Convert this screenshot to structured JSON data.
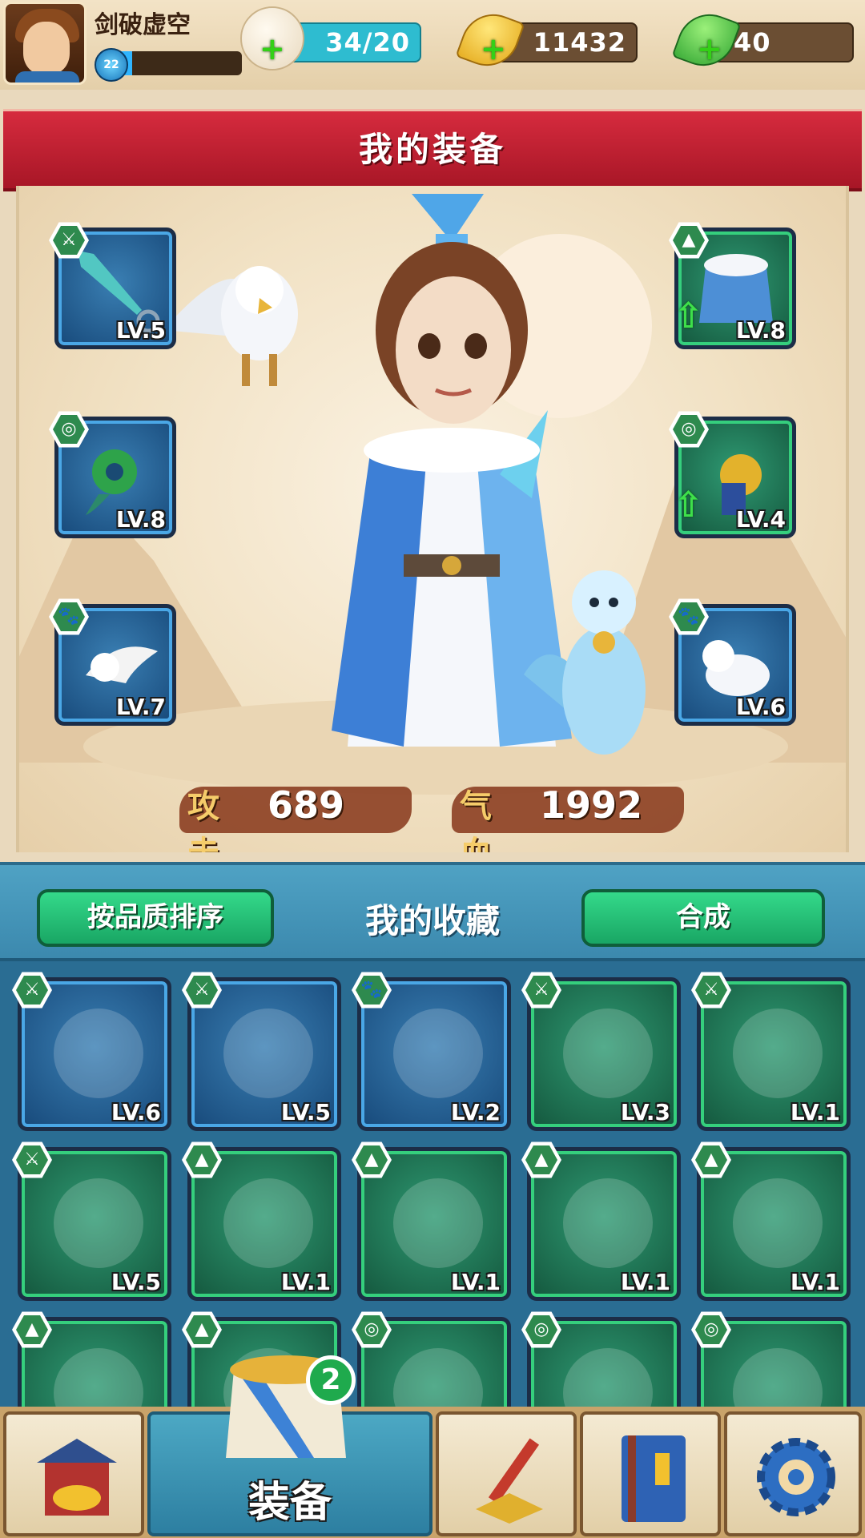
{
  "player": {
    "name": "剑破虚空",
    "level": "22",
    "xp_fraction": 0.12
  },
  "resources": {
    "stamina": "34/20",
    "gold": "11432",
    "jade": "40"
  },
  "header": {
    "title": "我的装备"
  },
  "equipped": {
    "left": [
      {
        "type": "weapon",
        "level": "LV.5",
        "quality": "blue",
        "icon": "dagger-icon"
      },
      {
        "type": "accessory",
        "level": "LV.8",
        "quality": "blue",
        "icon": "jade-pendant-icon"
      },
      {
        "type": "pet",
        "level": "LV.7",
        "quality": "blue",
        "icon": "bird-pet-icon"
      }
    ],
    "right": [
      {
        "type": "armor",
        "level": "LV.8",
        "quality": "green",
        "icon": "fur-robe-icon",
        "upgradable": true
      },
      {
        "type": "accessory",
        "level": "LV.4",
        "quality": "green",
        "icon": "gold-pendant-icon",
        "upgradable": true
      },
      {
        "type": "pet",
        "level": "LV.6",
        "quality": "blue",
        "icon": "ferret-pet-icon"
      }
    ]
  },
  "stats": {
    "attack_label": "攻击",
    "attack_value": "689",
    "hp_label": "气血",
    "hp_value": "1992"
  },
  "collection": {
    "sort_button": "按品质排序",
    "title": "我的收藏",
    "merge_button": "合成",
    "rows": [
      [
        {
          "type": "weapon",
          "level": "LV.6",
          "quality": "blue",
          "icon": "sword-icon"
        },
        {
          "type": "weapon",
          "level": "LV.5",
          "quality": "blue",
          "icon": "fan-icon"
        },
        {
          "type": "pet",
          "level": "LV.2",
          "quality": "blue",
          "icon": "monkey-icon"
        },
        {
          "type": "weapon",
          "level": "LV.3",
          "quality": "green",
          "icon": "folding-fan-icon"
        },
        {
          "type": "weapon",
          "level": "LV.1",
          "quality": "green",
          "icon": "crossbow-icon"
        }
      ],
      [
        {
          "type": "weapon",
          "level": "LV.5",
          "quality": "green",
          "icon": "crossbow-icon"
        },
        {
          "type": "armor",
          "level": "LV.1",
          "quality": "green",
          "icon": "leather-armor-icon"
        },
        {
          "type": "armor",
          "level": "LV.1",
          "quality": "green",
          "icon": "leather-armor-icon"
        },
        {
          "type": "armor",
          "level": "LV.1",
          "quality": "green",
          "icon": "fur-robe-icon"
        },
        {
          "type": "armor",
          "level": "LV.1",
          "quality": "green",
          "icon": "gold-armor-icon"
        }
      ],
      [
        {
          "type": "armor",
          "level": "",
          "quality": "green",
          "icon": "gold-armor-icon"
        },
        {
          "type": "armor",
          "level": "",
          "quality": "green",
          "icon": "armor-icon"
        },
        {
          "type": "accessory",
          "level": "",
          "quality": "green",
          "icon": "silver-pendant-icon"
        },
        {
          "type": "accessory",
          "level": "",
          "quality": "green",
          "icon": "phoenix-pendant-icon"
        },
        {
          "type": "accessory",
          "level": "",
          "quality": "green",
          "icon": "gold-pendant-icon"
        }
      ]
    ]
  },
  "nav": {
    "shop_icon": "shop-icon",
    "equip_label": "装备",
    "equip_badge": "2",
    "skills_icon": "weapons-icon",
    "book_icon": "book-icon",
    "settings_icon": "gear-icon"
  },
  "colors": {
    "banner_red": "#c8212f",
    "quality_blue": "#4aa7e6",
    "quality_green": "#35cf7d",
    "button_green": "#19a664",
    "panel_teal": "#3b88ad"
  }
}
